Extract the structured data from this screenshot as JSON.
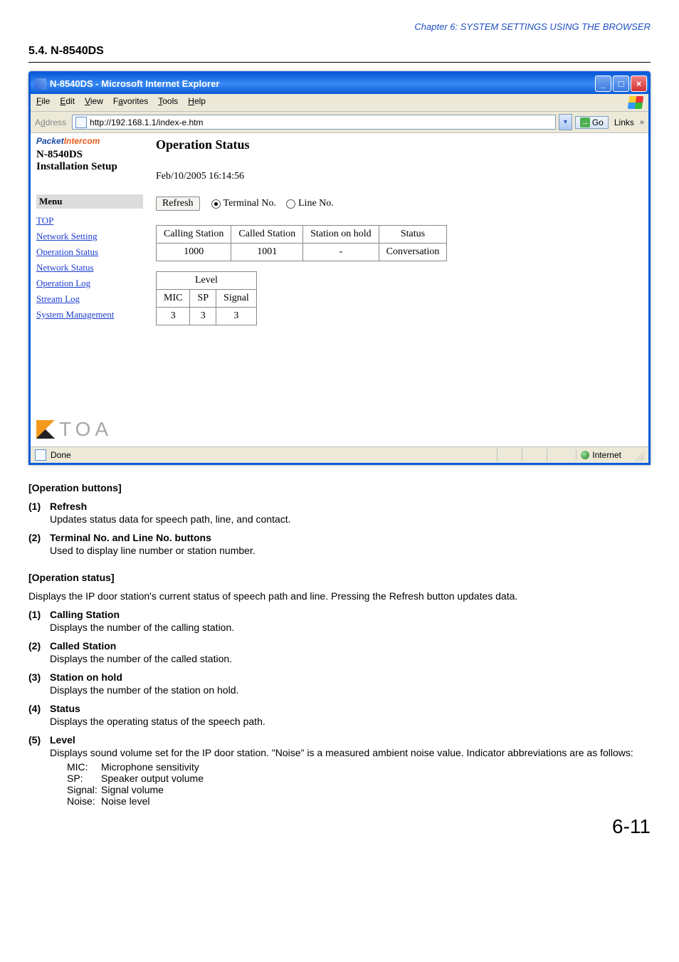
{
  "chapter_header": "Chapter 6:  SYSTEM SETTINGS USING THE BROWSER",
  "section_title": "5.4. N-8540DS",
  "browser": {
    "title": "N-8540DS - Microsoft Internet Explorer",
    "menus": {
      "file": "File",
      "edit": "Edit",
      "view": "View",
      "favorites": "Favorites",
      "tools": "Tools",
      "help": "Help"
    },
    "address_label": "Address",
    "url": "http://192.168.1.1/index-e.htm",
    "go_label": "Go",
    "links_label": "Links",
    "status_done": "Done",
    "status_zone": "Internet"
  },
  "sidebar": {
    "logo_part1": "Packet",
    "logo_part2": "Intercom",
    "device": "N-8540DS",
    "install": "Installation Setup",
    "menu_header": "Menu",
    "items": {
      "top": "TOP",
      "network_setting": "Network Setting",
      "operation_status": "Operation Status",
      "network_status": "Network Status",
      "operation_log": "Operation Log",
      "stream_log": "Stream Log",
      "system_management": "System Management"
    },
    "toa": "TOA"
  },
  "main": {
    "heading": "Operation Status",
    "timestamp": "Feb/10/2005 16:14:56",
    "refresh_label": "Refresh",
    "radio": {
      "terminal": "Terminal No.",
      "line": "Line No.",
      "selected": "terminal"
    },
    "status_table": {
      "headers": {
        "calling": "Calling Station",
        "called": "Called Station",
        "hold": "Station on hold",
        "status": "Status"
      },
      "row": {
        "calling": "1000",
        "called": "1001",
        "hold": "-",
        "status": "Conversation"
      }
    },
    "level_table": {
      "group_header": "Level",
      "headers": {
        "mic": "MIC",
        "sp": "SP",
        "signal": "Signal"
      },
      "row": {
        "mic": "3",
        "sp": "3",
        "signal": "3"
      }
    }
  },
  "doc": {
    "op_buttons_heading": "[Operation buttons]",
    "b1_num": "(1)",
    "b1_title": "Refresh",
    "b1_desc": "Updates status data for speech path, line, and contact.",
    "b2_num": "(2)",
    "b2_title": "Terminal No. and Line No. buttons",
    "b2_desc": "Used to display line number or station number.",
    "op_status_heading": "[Operation status]",
    "op_status_intro": "Displays the IP door station's current status of speech path and line. Pressing the Refresh button updates data.",
    "s1_num": "(1)",
    "s1_title": "Calling Station",
    "s1_desc": "Displays the number of the calling station.",
    "s2_num": "(2)",
    "s2_title": "Called Station",
    "s2_desc": "Displays the number of the called station.",
    "s3_num": "(3)",
    "s3_title": "Station on hold",
    "s3_desc": "Displays the number of the station on hold.",
    "s4_num": "(4)",
    "s4_title": "Status",
    "s4_desc": "Displays the operating status of the speech path.",
    "s5_num": "(5)",
    "s5_title": "Level",
    "s5_desc": "Displays sound volume set for the IP door station. \"Noise\" is a measured ambient noise value. Indicator abbreviations are as follows:",
    "abbr": {
      "mic_k": "MIC:",
      "mic_v": "Microphone sensitivity",
      "sp_k": "SP:",
      "sp_v": "Speaker output volume",
      "signal_k": "Signal:",
      "signal_v": "Signal volume",
      "noise_k": "Noise:",
      "noise_v": "Noise level"
    }
  },
  "page_number": "6-11"
}
